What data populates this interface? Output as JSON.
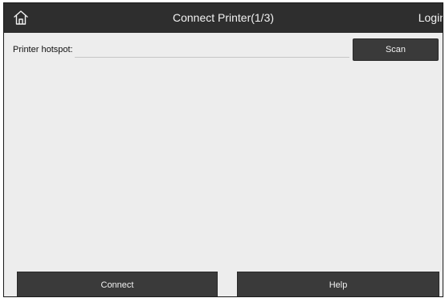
{
  "header": {
    "title": "Connect Printer(1/3)",
    "login_label": "Login",
    "home_icon": "home-icon"
  },
  "form": {
    "hotspot_label": "Printer hotspot:",
    "hotspot_value": "",
    "scan_label": "Scan"
  },
  "footer": {
    "connect_label": "Connect",
    "help_label": "Help"
  },
  "colors": {
    "topbar": "#2e2e2e",
    "background": "#ededed",
    "button": "#3a3a3a",
    "button_text": "#f0f0f0"
  }
}
